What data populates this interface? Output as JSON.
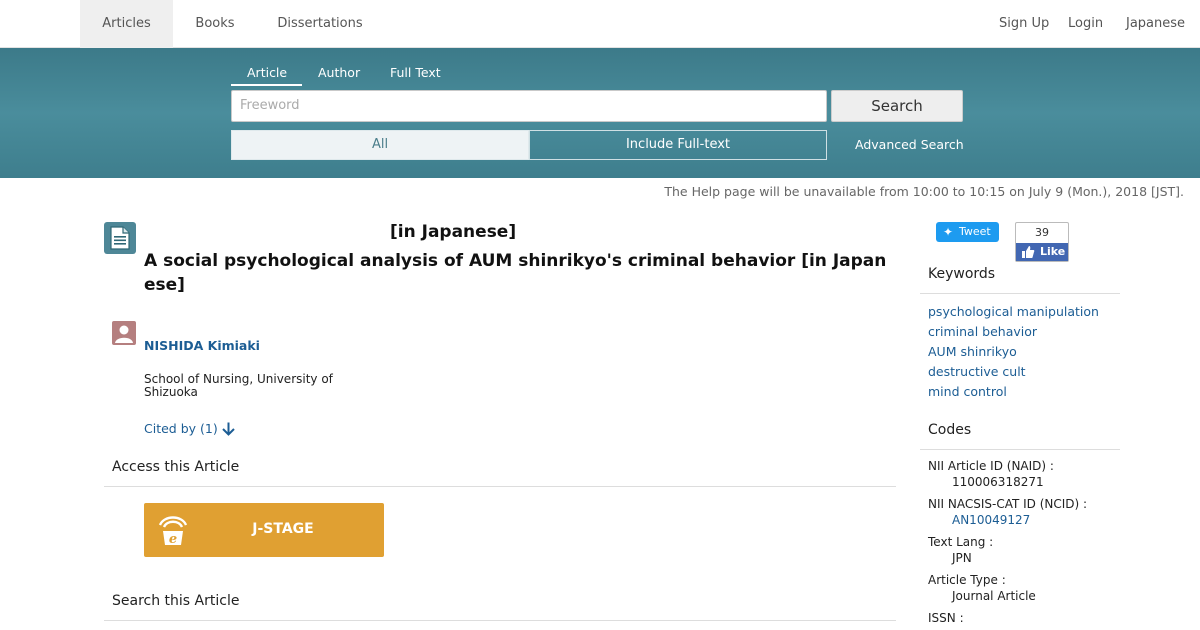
{
  "topnav": {
    "tabs": [
      {
        "label": "Articles",
        "active": true
      },
      {
        "label": "Books",
        "active": false
      },
      {
        "label": "Dissertations",
        "active": false
      }
    ],
    "right": [
      "Sign Up",
      "Login",
      "Japanese"
    ]
  },
  "search": {
    "tabs": [
      "Article",
      "Author",
      "Full Text"
    ],
    "active_tab": "Article",
    "placeholder": "Freeword",
    "button": "Search",
    "scope_all": "All",
    "scope_full": "Include Full-text",
    "advanced": "Advanced Search"
  },
  "notice": "The Help page will be unavailable from 10:00 to 10:15 on July 9 (Mon.), 2018 [JST].",
  "article": {
    "title_jp": "[in Japanese]",
    "title_en": "A social psychological analysis of AUM shinrikyo's criminal behavior  [in Japanese]",
    "author": "NISHIDA Kimiaki",
    "affiliation": "School of Nursing, University of Shizuoka",
    "cited_by": "Cited by (1)",
    "access_heading": "Access this Article",
    "jstage_label": "J-STAGE",
    "search_heading": "Search this Article"
  },
  "social": {
    "tweet": "Tweet",
    "like_count": "39",
    "like": "Like"
  },
  "sidebar": {
    "keywords_heading": "Keywords",
    "keywords": [
      "psychological manipulation",
      "criminal behavior",
      "AUM shinrikyo",
      "destructive cult",
      "mind control"
    ],
    "codes_heading": "Codes",
    "codes": [
      {
        "key": "NII Article ID (NAID) :",
        "value": "110006318271",
        "link": false
      },
      {
        "key": "NII NACSIS-CAT ID (NCID) :",
        "value": "AN10049127",
        "link": true
      },
      {
        "key": "Text Lang :",
        "value": "JPN",
        "link": false
      },
      {
        "key": "Article Type :",
        "value": "Journal Article",
        "link": false
      },
      {
        "key": "ISSN :",
        "value": "",
        "link": false
      }
    ]
  },
  "colors": {
    "band": "#4a8d9c",
    "link": "#1c5d94",
    "jstage": "#e0a032"
  }
}
